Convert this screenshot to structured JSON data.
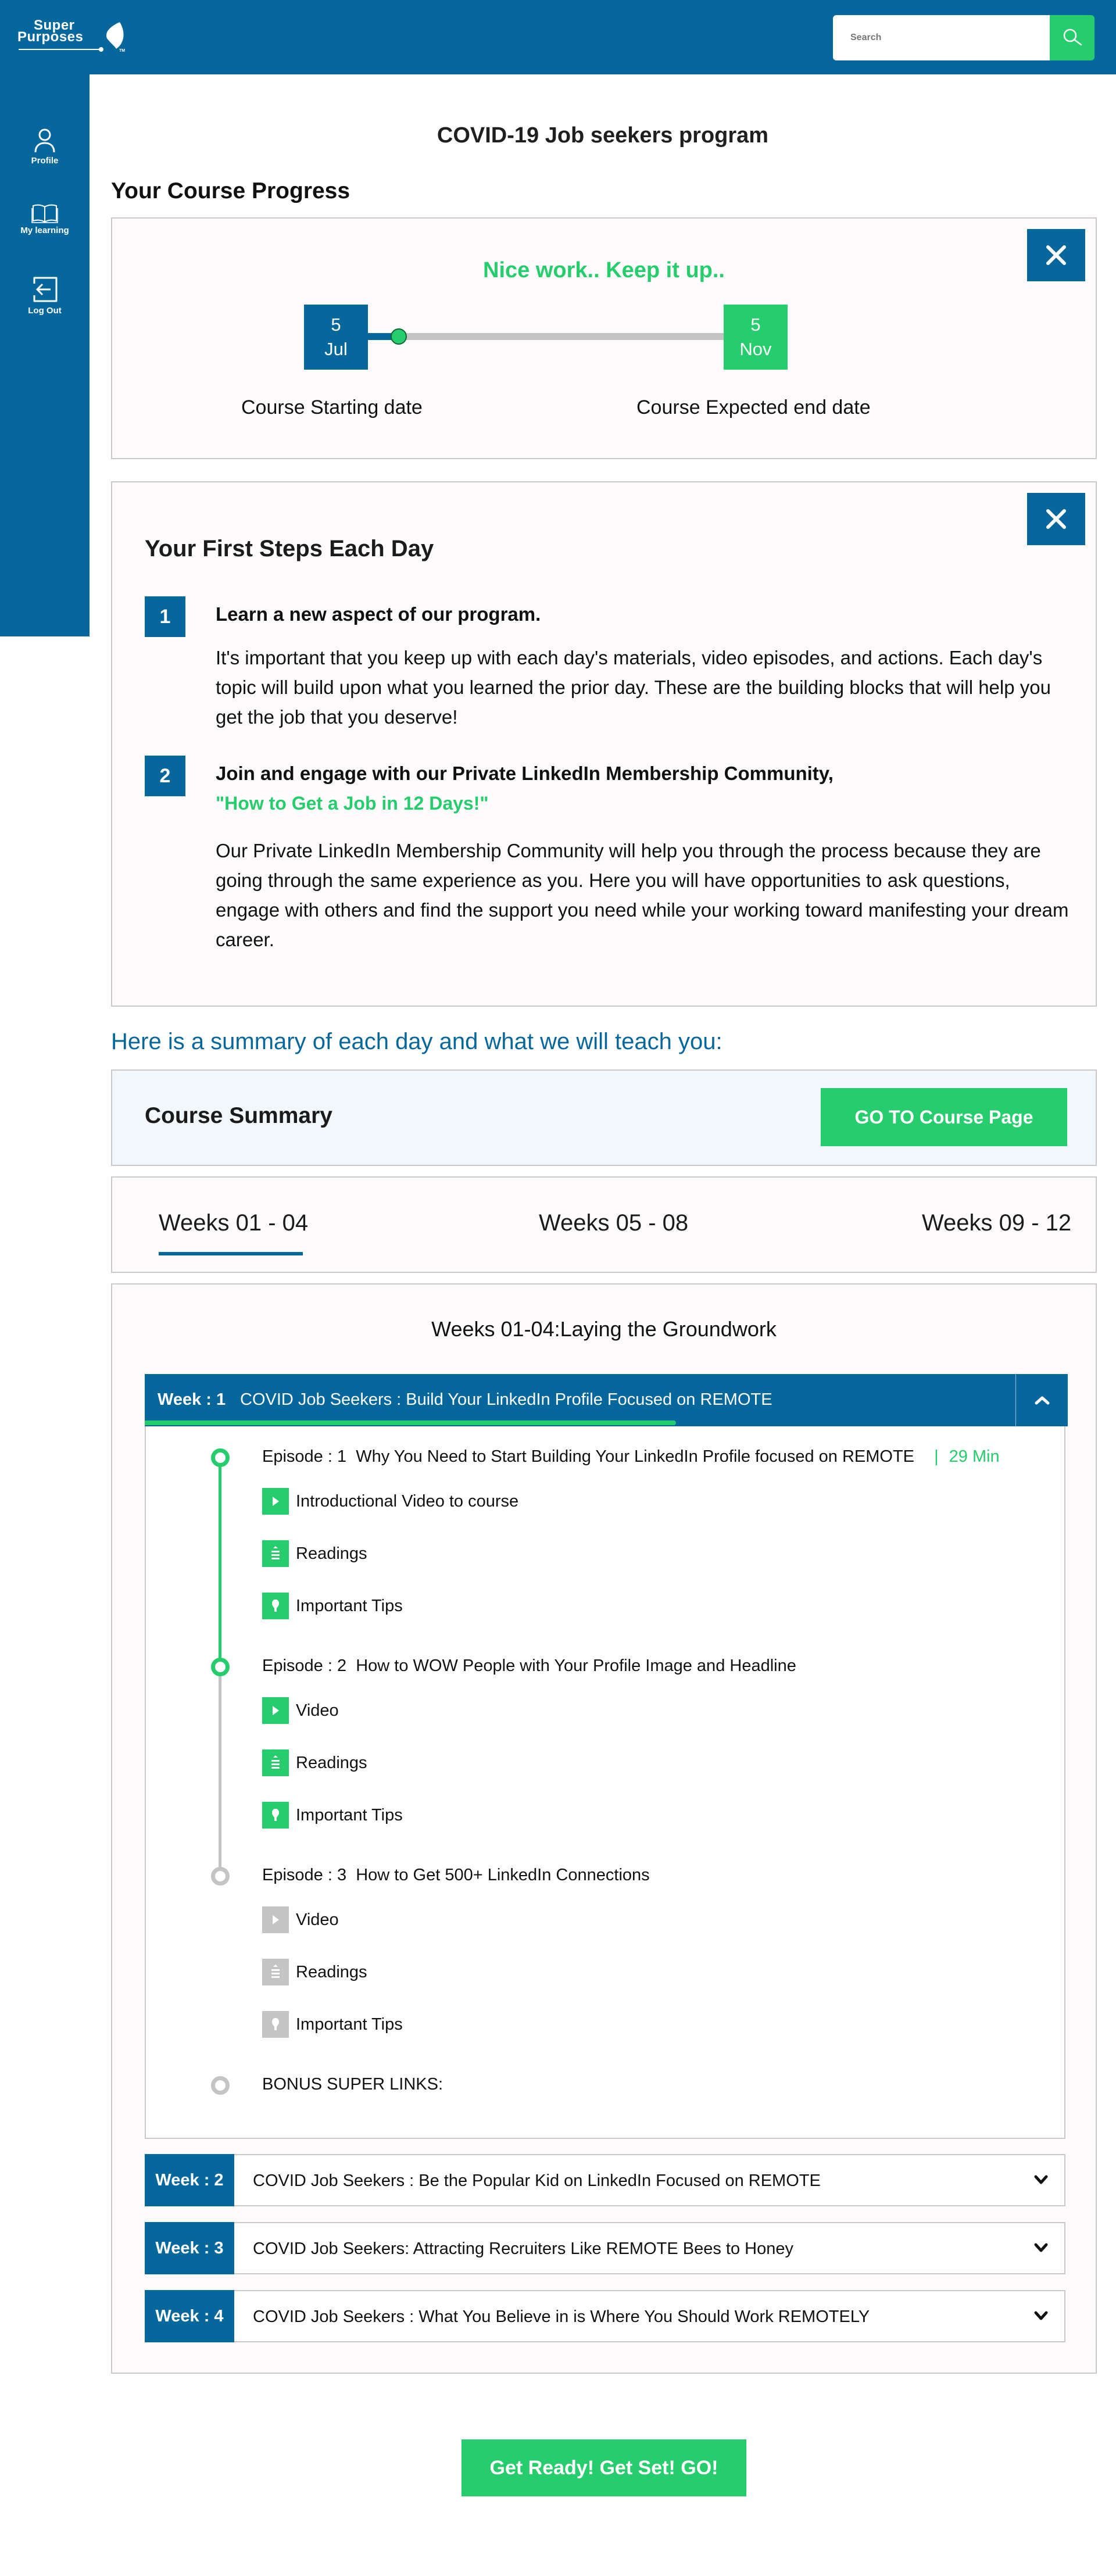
{
  "header": {
    "logo_line1": "Super",
    "logo_line2": "Purposes",
    "logo_tm": "TM",
    "search_placeholder": "Search"
  },
  "sidebar": {
    "items": [
      {
        "label": "Profile",
        "icon": "user-icon"
      },
      {
        "label": "My learning",
        "icon": "book-icon"
      },
      {
        "label": "Log Out",
        "icon": "logout-icon"
      }
    ]
  },
  "page": {
    "title": "COVID-19 Job seekers program"
  },
  "progress": {
    "heading": "Your Course Progress",
    "message": "Nice work.. Keep it up..",
    "start_day": "5",
    "start_month": "Jul",
    "end_day": "5",
    "end_month": "Nov",
    "start_label": "Course Starting date",
    "end_label": "Course Expected end date",
    "fraction_complete": 0.07
  },
  "first_steps": {
    "title": "Your First Steps Each Day",
    "steps": [
      {
        "number": "1",
        "heading": "Learn a new aspect of our program.",
        "subheading": "",
        "body": "It's important that you keep up with each day's materials, video episodes, and actions. Each day's topic will build upon what you learned the prior day. These are the building blocks that will help you get the job that you deserve!"
      },
      {
        "number": "2",
        "heading": "Join and engage with our Private LinkedIn Membership Community,",
        "subheading": "\"How to Get a Job in 12 Days!\"",
        "body": "Our Private LinkedIn Membership Community will help you through the process because they are going through the same experience as you. Here you will have opportunities to ask questions, engage with others and find the support you need while your working toward manifesting your dream career."
      }
    ]
  },
  "summary": {
    "intro": "Here is a summary of each day and what we will teach you:",
    "title": "Course Summary",
    "go_button": "GO TO Course Page"
  },
  "tabs": [
    {
      "label": "Weeks 01 - 04",
      "active": true
    },
    {
      "label": "Weeks 05 - 08",
      "active": false
    },
    {
      "label": "Weeks 09 - 12",
      "active": false
    }
  ],
  "weeks_section": {
    "title": "Weeks 01-04:Laying the Groundwork",
    "week1": {
      "label": "Week : 1",
      "title": "COVID Job Seekers : Build Your LinkedIn Profile Focused on REMOTE",
      "progress_fraction": 0.61,
      "episodes": [
        {
          "label": "Episode : 1",
          "title": "Why You Need to Start Building Your LinkedIn Profile focused on REMOTE",
          "separator": "|",
          "duration": "29 Min",
          "status": "done",
          "resources": [
            {
              "type": "video",
              "label": "Introductional Video to course"
            },
            {
              "type": "readings",
              "label": "Readings"
            },
            {
              "type": "tips",
              "label": "Important Tips"
            }
          ]
        },
        {
          "label": "Episode : 2",
          "title": "How to WOW People with Your Profile Image and Headline",
          "duration": "",
          "status": "done",
          "resources": [
            {
              "type": "video",
              "label": "Video"
            },
            {
              "type": "readings",
              "label": "Readings"
            },
            {
              "type": "tips",
              "label": "Important Tips"
            }
          ]
        },
        {
          "label": "Episode : 3",
          "title": "How to Get 500+ LinkedIn Connections",
          "duration": "",
          "status": "locked",
          "resources": [
            {
              "type": "video",
              "label": "Video"
            },
            {
              "type": "readings",
              "label": "Readings"
            },
            {
              "type": "tips",
              "label": "Important Tips"
            }
          ]
        }
      ],
      "bonus": "BONUS SUPER LINKS:"
    },
    "other_weeks": [
      {
        "label": "Week : 2",
        "title": "COVID Job Seekers : Be the Popular Kid on LinkedIn Focused on REMOTE"
      },
      {
        "label": "Week : 3",
        "title": "COVID Job Seekers: Attracting Recruiters Like REMOTE Bees to Honey"
      },
      {
        "label": "Week : 4",
        "title": "COVID Job Seekers : What You Believe in is Where You Should Work REMOTELY"
      }
    ]
  },
  "cta": {
    "label": "Get Ready! Get Set! GO!"
  },
  "colors": {
    "brand_blue": "#06679c",
    "accent_green": "#26cd6c",
    "locked_gray": "#c4c4c4"
  }
}
